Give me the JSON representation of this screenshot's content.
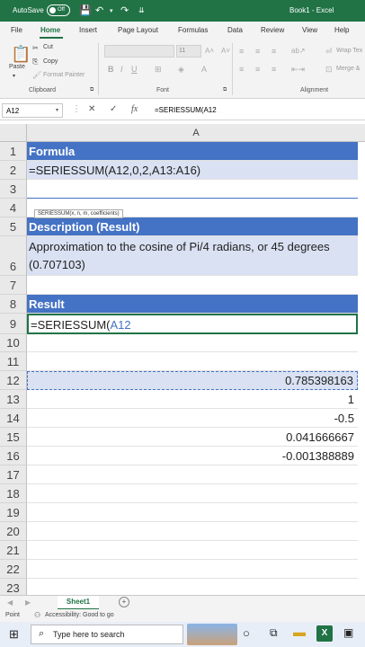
{
  "titlebar": {
    "autosave": "AutoSave",
    "toggle": "Off",
    "document": "Book1 - Excel"
  },
  "tabs": [
    "File",
    "Home",
    "Insert",
    "Page Layout",
    "Formulas",
    "Data",
    "Review",
    "View",
    "Help"
  ],
  "ribbon": {
    "paste": "Paste",
    "cut": "Cut",
    "copy": "Copy",
    "format_painter": "Format Painter",
    "clipboard": "Clipboard",
    "font": "Font",
    "alignment": "Alignment",
    "wrap_text": "Wrap Tex",
    "merge": "Merge &",
    "font_size": "11"
  },
  "formula_bar": {
    "name_box": "A12",
    "formula": "=SERIESSUM(A12"
  },
  "column_header": "A",
  "rows": [
    {
      "n": "1",
      "v": "Formula"
    },
    {
      "n": "2",
      "v": "=SERIESSUM(A12,0,2,A13:A16)"
    },
    {
      "n": "3",
      "v": ""
    },
    {
      "n": "4",
      "v": ""
    },
    {
      "n": "5",
      "v": "Description (Result)"
    },
    {
      "n": "6",
      "v": "Approximation to the cosine of Pi/4 radians, or 45 degrees",
      "v2": "(0.707103)"
    },
    {
      "n": "7",
      "v": ""
    },
    {
      "n": "8",
      "v": "Result"
    },
    {
      "n": "9",
      "v": "=SERIESSUM(",
      "v_ref": "A12"
    },
    {
      "n": "10",
      "v": ""
    },
    {
      "n": "11",
      "v": ""
    },
    {
      "n": "12",
      "v": "0.785398163"
    },
    {
      "n": "13",
      "v": "1"
    },
    {
      "n": "14",
      "v": "-0.5"
    },
    {
      "n": "15",
      "v": "0.041666667"
    },
    {
      "n": "16",
      "v": "-0.001388889"
    },
    {
      "n": "17",
      "v": ""
    },
    {
      "n": "18",
      "v": ""
    },
    {
      "n": "19",
      "v": ""
    },
    {
      "n": "20",
      "v": ""
    },
    {
      "n": "21",
      "v": ""
    },
    {
      "n": "22",
      "v": ""
    },
    {
      "n": "23",
      "v": ""
    }
  ],
  "tooltip": "SERIESSUM(x, n, m, coefficients)",
  "sheet": {
    "name": "Sheet1",
    "add": "+"
  },
  "status": {
    "mode": "Point",
    "accessibility": "Accessibility: Good to go"
  },
  "taskbar": {
    "search": "Type here to search"
  },
  "colors": {
    "excel_green": "#217346",
    "header_blue": "#4472c4",
    "band_blue": "#d9e1f2"
  }
}
